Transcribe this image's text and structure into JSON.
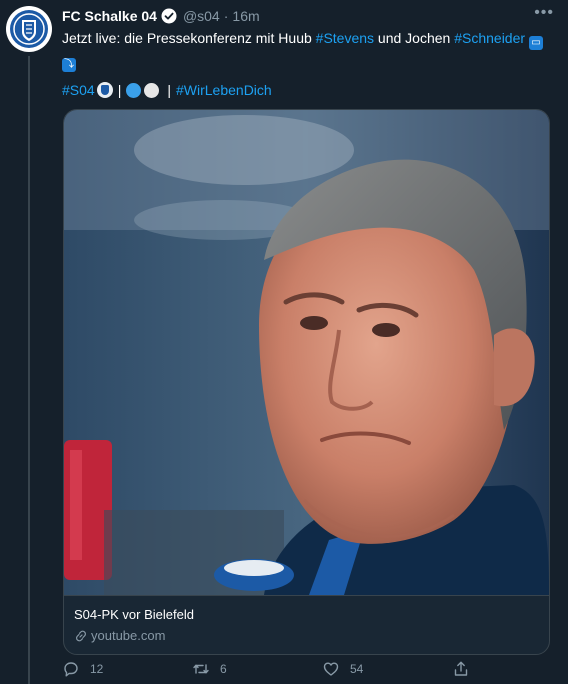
{
  "author": {
    "name": "FC Schalke 04",
    "handle": "@s04",
    "time": "16m",
    "more": "•••"
  },
  "tweet": {
    "text_before": "Jetzt live: die Pressekonferenz mit Huub ",
    "tag_stevens": "#Stevens",
    "text_mid": " und Jochen ",
    "tag_schneider": "#Schneider",
    "line2_tag": "#S04",
    "line2_separator": "|",
    "line2_hashtag": "#WirLebenDich"
  },
  "card": {
    "title": "S04-PK vor Bielefeld",
    "domain": "youtube.com"
  },
  "actions": {
    "replies": "12",
    "retweets": "6",
    "likes": "54"
  },
  "colors": {
    "background": "#15202b",
    "link": "#1da1f2",
    "muted": "#8899a6",
    "border": "#38444d",
    "schalke_blue": "#1c5aa6"
  }
}
